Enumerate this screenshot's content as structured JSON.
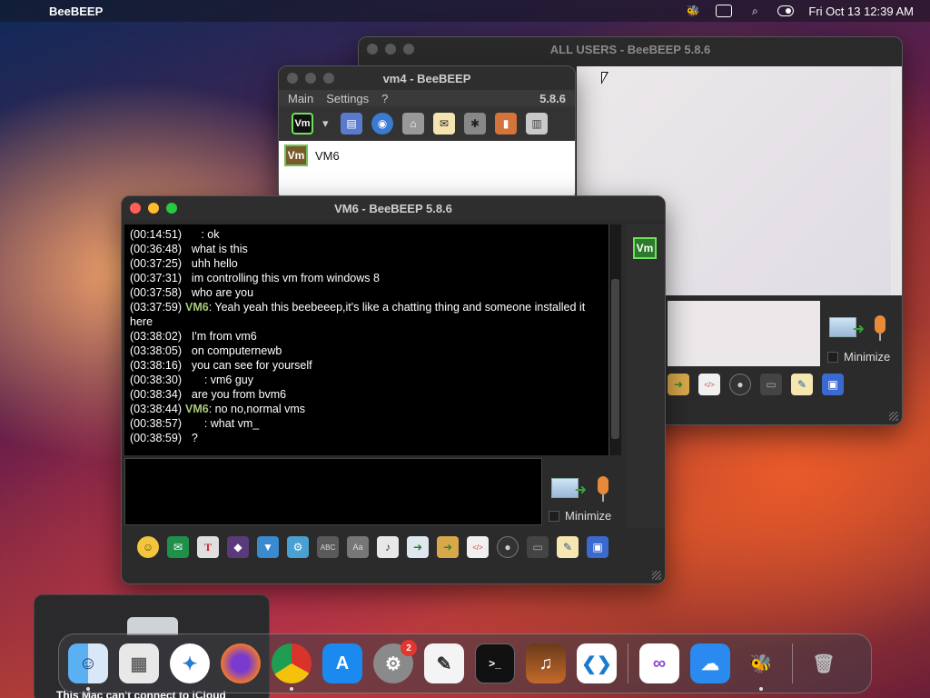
{
  "menubar": {
    "app_name": "BeeBEEP",
    "datetime": "Fri Oct 13  12:39 AM",
    "icons": [
      "apple-icon",
      "bee-status-icon",
      "screen-mirror-icon",
      "spotlight-search-icon",
      "control-center-icon"
    ]
  },
  "all_users_window": {
    "title": "ALL USERS - BeeBEEP 5.8.6",
    "minimize_label": "Minimize"
  },
  "vm4_window": {
    "title": "vm4 - BeeBEEP",
    "menu": {
      "main": "Main",
      "settings": "Settings",
      "help": "?",
      "version": "5.8.6"
    },
    "toolbar_vm_label": "Vm",
    "users": [
      {
        "badge": "Vm",
        "name": "VM6"
      }
    ]
  },
  "vm6_window": {
    "title": "VM6 - BeeBEEP 5.8.6",
    "side_badge": "Vm",
    "minimize_label": "Minimize",
    "messages": [
      {
        "time": "(00:14:51)",
        "who": "",
        "text": "     : ok"
      },
      {
        "time": "(00:36:48)",
        "who": "",
        "text": "  what is this"
      },
      {
        "time": "(00:37:25)",
        "who": "",
        "text": "  uhh hello"
      },
      {
        "time": "(00:37:31)",
        "who": "",
        "text": "  im controlling this vm from windows 8"
      },
      {
        "time": "(00:37:58)",
        "who": "",
        "text": "  who are you"
      },
      {
        "time": "(03:37:59)",
        "who": "VM6",
        "text": ": Yeah yeah this beebeeep,it's like a chatting thing and someone installed it here"
      },
      {
        "time": "(03:38:02)",
        "who": "",
        "text": "  I'm from vm6"
      },
      {
        "time": "(03:38:05)",
        "who": "",
        "text": "  on computernewb"
      },
      {
        "time": "(03:38:16)",
        "who": "",
        "text": "  you can see for yourself"
      },
      {
        "time": "(00:38:30)",
        "who": "",
        "text": "      : vm6 guy"
      },
      {
        "time": "(00:38:34)",
        "who": "",
        "text": "  are you from bvm6"
      },
      {
        "time": "(03:38:44)",
        "who": "VM6",
        "text": ": no no,normal vms"
      },
      {
        "time": "(00:38:57)",
        "who": "",
        "text": "      : what vm_"
      },
      {
        "time": "(00:38:59)",
        "who": "",
        "text": "  ?"
      }
    ]
  },
  "notification": {
    "text": "This Mac can't connect to iCloud"
  },
  "dock": {
    "settings_badge": "2",
    "apps": [
      "Finder",
      "Launchpad",
      "Safari",
      "Firefox",
      "Chrome",
      "App Store",
      "System Settings",
      "TextEdit",
      "Terminal",
      "GarageBand",
      "VS Code",
      "Visual Studio",
      "Weather",
      "BeeBEEP",
      "Trash"
    ]
  }
}
